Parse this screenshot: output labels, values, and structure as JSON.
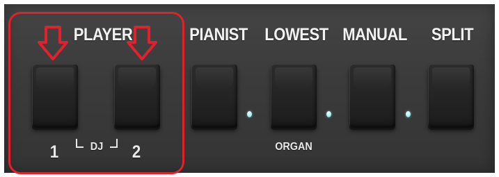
{
  "panel": {
    "labels": {
      "player": "PLAYER",
      "pianist": "PIANIST",
      "lowest": "LOWEST",
      "manual": "MANUAL",
      "split": "SPLIT",
      "player_1": "1",
      "player_2": "2",
      "dj": "DJ",
      "organ": "ORGAN"
    },
    "colors": {
      "highlight": "#e0222d",
      "panel": "#3d3d3d",
      "label": "#f2f2f2",
      "led": "#aef4f7"
    },
    "icons": {
      "arrow": "down-arrow-outline-icon"
    }
  }
}
